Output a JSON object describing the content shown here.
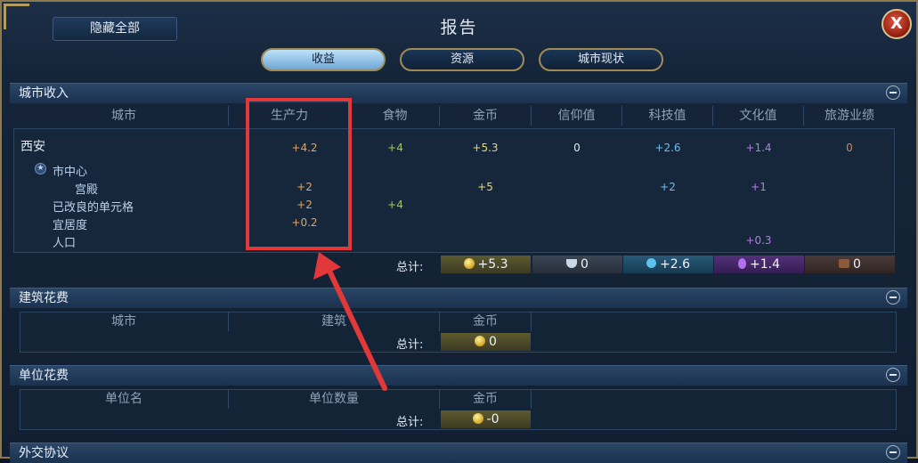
{
  "window": {
    "title": "报告",
    "hide_all": "隐藏全部",
    "close": "X"
  },
  "tabs": [
    {
      "label": "收益",
      "active": true
    },
    {
      "label": "资源",
      "active": false
    },
    {
      "label": "城市现状",
      "active": false
    }
  ],
  "city_income": {
    "title": "城市收入",
    "columns": [
      "城市",
      "生产力",
      "食物",
      "金币",
      "信仰值",
      "科技值",
      "文化值",
      "旅游业绩"
    ],
    "city": {
      "name": "西安",
      "production": "+4.2",
      "food": "+4",
      "gold": "+5.3",
      "faith": "0",
      "science": "+2.6",
      "culture": "+1.4",
      "tourism": "0"
    },
    "rows": [
      {
        "label": "市中心",
        "production": "",
        "food": "",
        "gold": "",
        "science": "",
        "culture": ""
      },
      {
        "label": "宫殿",
        "production": "+2",
        "food": "",
        "gold": "+5",
        "science": "+2",
        "culture": "+1"
      },
      {
        "label": "已改良的单元格",
        "production": "+2",
        "food": "+4",
        "gold": "",
        "science": "",
        "culture": ""
      },
      {
        "label": "宜居度",
        "production": "+0.2",
        "food": "",
        "gold": "",
        "science": "",
        "culture": ""
      },
      {
        "label": "人口",
        "production": "",
        "food": "",
        "gold": "",
        "science": "",
        "culture": "+0.3"
      }
    ],
    "total_label": "总计:",
    "totals": {
      "gold": "+5.3",
      "faith": "0",
      "science": "+2.6",
      "culture": "+1.4",
      "tourism": "0"
    }
  },
  "building_costs": {
    "title": "建筑花费",
    "columns": [
      "城市",
      "建筑",
      "金币"
    ],
    "total_label": "总计:",
    "total_gold": "0"
  },
  "unit_costs": {
    "title": "单位花费",
    "columns": [
      "单位名",
      "单位数量",
      "金币"
    ],
    "total_label": "总计:",
    "total_gold": "-0"
  },
  "diplomacy": {
    "title": "外交协议"
  },
  "colors": {
    "highlight": "#e3383a",
    "production": "#e0a463",
    "food": "#9ccd5a",
    "gold": "#e7d872",
    "science": "#6fbde8",
    "culture": "#b67be3"
  }
}
